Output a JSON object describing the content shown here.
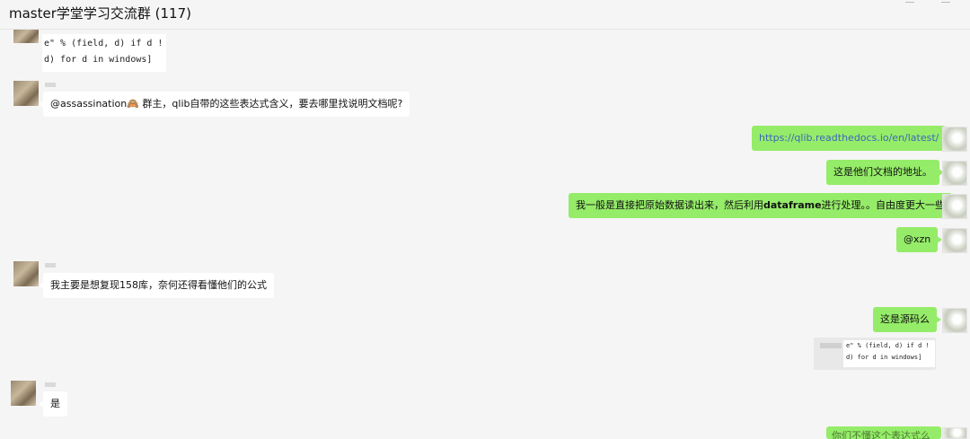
{
  "window": {
    "title": "master学堂学习交流群 (117)"
  },
  "messages": {
    "code_top": {
      "line1": "e\" % (field, d) if d !",
      "line2": "d) for d in windows]"
    },
    "m1": {
      "text": "@assassination🙈 群主，qlib自带的这些表达式含义，要去哪里找说明文档呢?"
    },
    "m2": {
      "text": "https://qlib.readthedocs.io/en/latest/"
    },
    "m3": {
      "text": "这是他们文档的地址。"
    },
    "m4": {
      "prefix": "我一般是直接把原始数据读出来，然后利用",
      "bold": "dataframe",
      "suffix": "进行处理。。自由度更大一些"
    },
    "m5": {
      "text": "@xzn"
    },
    "m6": {
      "text": "我主要是想复现158库，奈何还得看懂他们的公式"
    },
    "m7": {
      "text": "这是源码么"
    },
    "m8": {
      "line1": "e\" % (field, d) if d !",
      "line2": "d) for d in windows]"
    },
    "m9": {
      "text": "是"
    },
    "m10": {
      "text": "你们不懂这个表达式么"
    }
  }
}
